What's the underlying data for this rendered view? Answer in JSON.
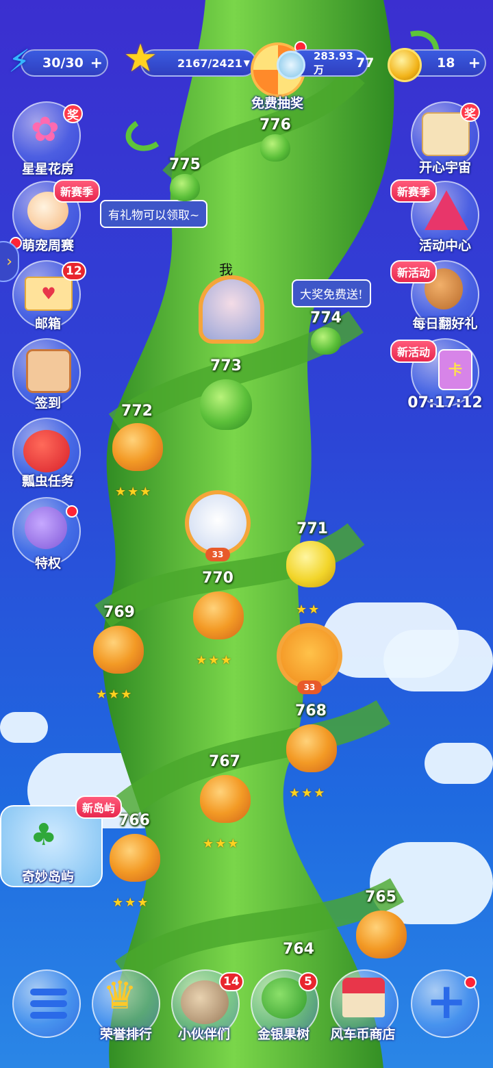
{
  "top_bar": {
    "energy": "30/30",
    "stars": "2167/2421",
    "free_lottery": "免费抽奖",
    "coins": "283.93万",
    "coins_extra": "77",
    "gold": "18",
    "plus": "+"
  },
  "left_menu": [
    {
      "label": "星星花房",
      "tag": "奖"
    },
    {
      "label": "萌宠周赛",
      "tag": "新赛季"
    },
    {
      "label": "邮箱",
      "badge": "12"
    },
    {
      "label": "签到"
    },
    {
      "label": "瓢虫任务"
    },
    {
      "label": "特权"
    }
  ],
  "right_menu": [
    {
      "label": "开心宇宙",
      "tag": "奖"
    },
    {
      "label": "活动中心",
      "tag": "新赛季"
    },
    {
      "label": "每日翻好礼",
      "tag": "新活动"
    },
    {
      "label": "07:17:12",
      "tag": "新活动",
      "tag_extra": "卡"
    }
  ],
  "bubbles": {
    "gift": "有礼物可以领取~",
    "prize": "大奖免费送!"
  },
  "me_label": "我",
  "island": {
    "tag": "新岛屿",
    "label": "奇妙岛屿"
  },
  "levels": [
    "776",
    "775",
    "774",
    "773",
    "772",
    "771",
    "770",
    "769",
    "768",
    "767",
    "766",
    "765",
    "764"
  ],
  "avatar_levels": [
    "33",
    "33"
  ],
  "stars_glyph": "★★★",
  "stars_glyph_two": "★★",
  "bottom_bar": [
    {
      "label": "荣誉排行"
    },
    {
      "label": "小伙伴们",
      "badge": "14"
    },
    {
      "label": "金银果树",
      "badge": "5"
    },
    {
      "label": "风车币商店"
    }
  ],
  "colors": {
    "stalk": "#5ec43a",
    "badge": "#e8262e",
    "star": "#ffd21f"
  }
}
